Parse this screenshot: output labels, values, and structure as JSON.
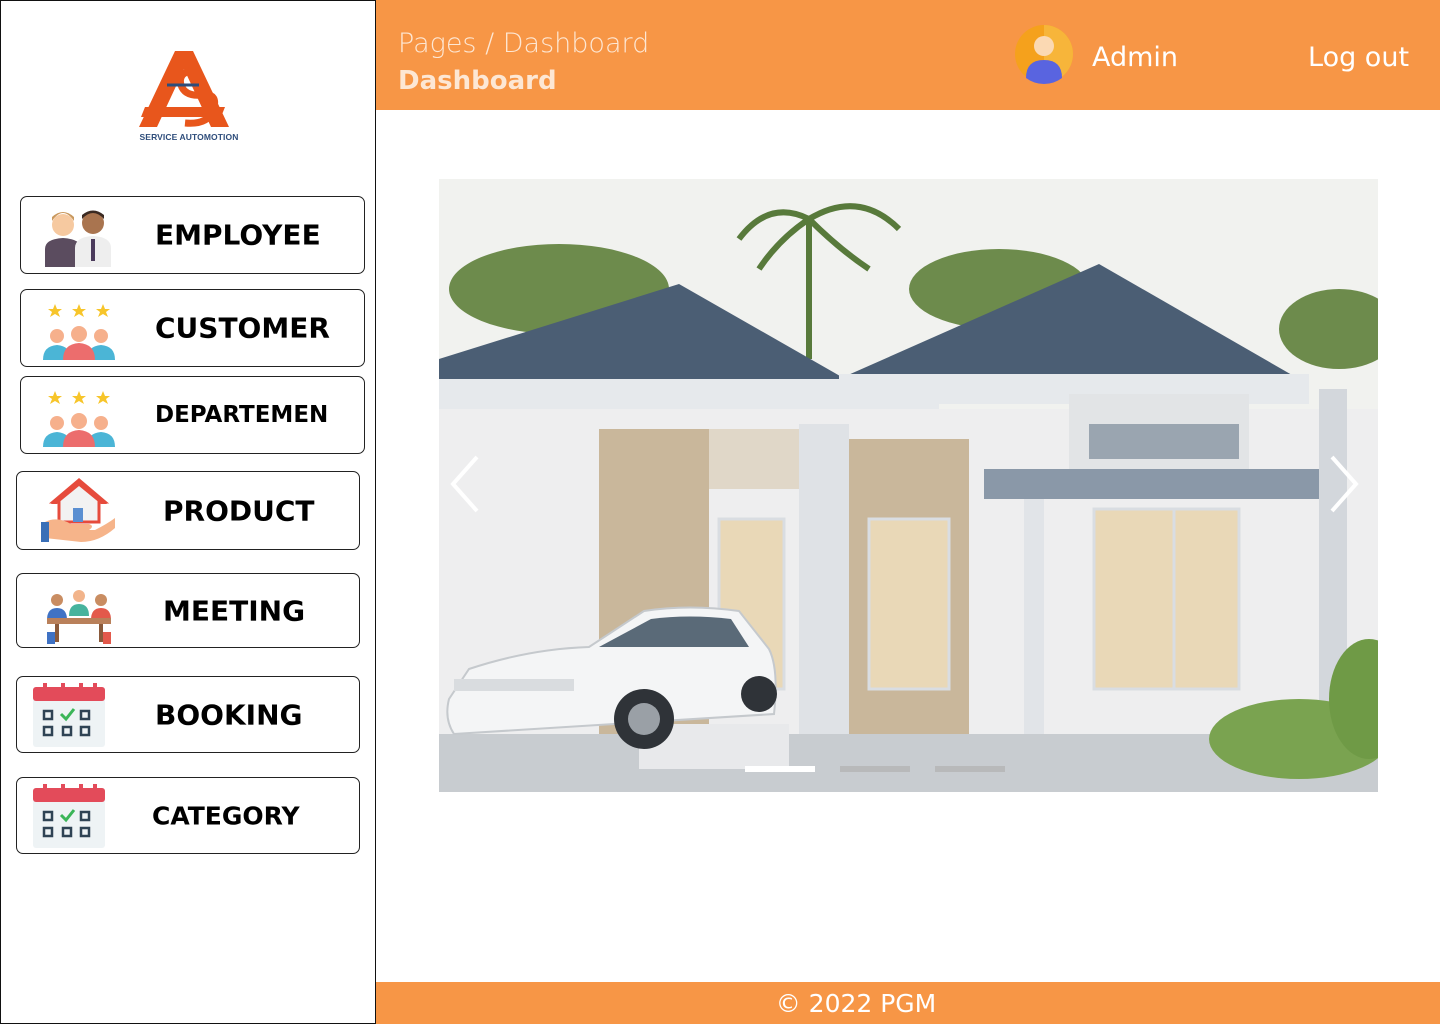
{
  "brand": {
    "logo_text": "SERVICE AUTOMOTION"
  },
  "nav": {
    "items": [
      {
        "label": "EMPLOYEE",
        "icon": "employees-icon"
      },
      {
        "label": "CUSTOMER",
        "icon": "rated-customers-icon"
      },
      {
        "label": "DEPARTEMEN",
        "icon": "rated-department-icon"
      },
      {
        "label": "PRODUCT",
        "icon": "house-in-hand-icon"
      },
      {
        "label": "MEETING",
        "icon": "meeting-table-icon"
      },
      {
        "label": "BOOKING",
        "icon": "calendar-check-icon"
      },
      {
        "label": "CATEGORY",
        "icon": "calendar-check-icon"
      }
    ]
  },
  "header": {
    "breadcrumb": {
      "root": "Pages",
      "separator": " / ",
      "current": "Dashboard"
    },
    "title": "Dashboard",
    "user_name": "Admin",
    "logout_label": "Log out"
  },
  "carousel": {
    "image": "house-with-car-photo",
    "slide_count": 3,
    "active_slide": 1,
    "prev_icon": "chevron-left-icon",
    "next_icon": "chevron-right-icon"
  },
  "footer": {
    "text": "© 2022 PGM"
  },
  "colors": {
    "accent": "#f79646",
    "header_text": "#fde7d4",
    "logo_orange": "#e8561c",
    "logo_navy": "#2e4d7b"
  }
}
